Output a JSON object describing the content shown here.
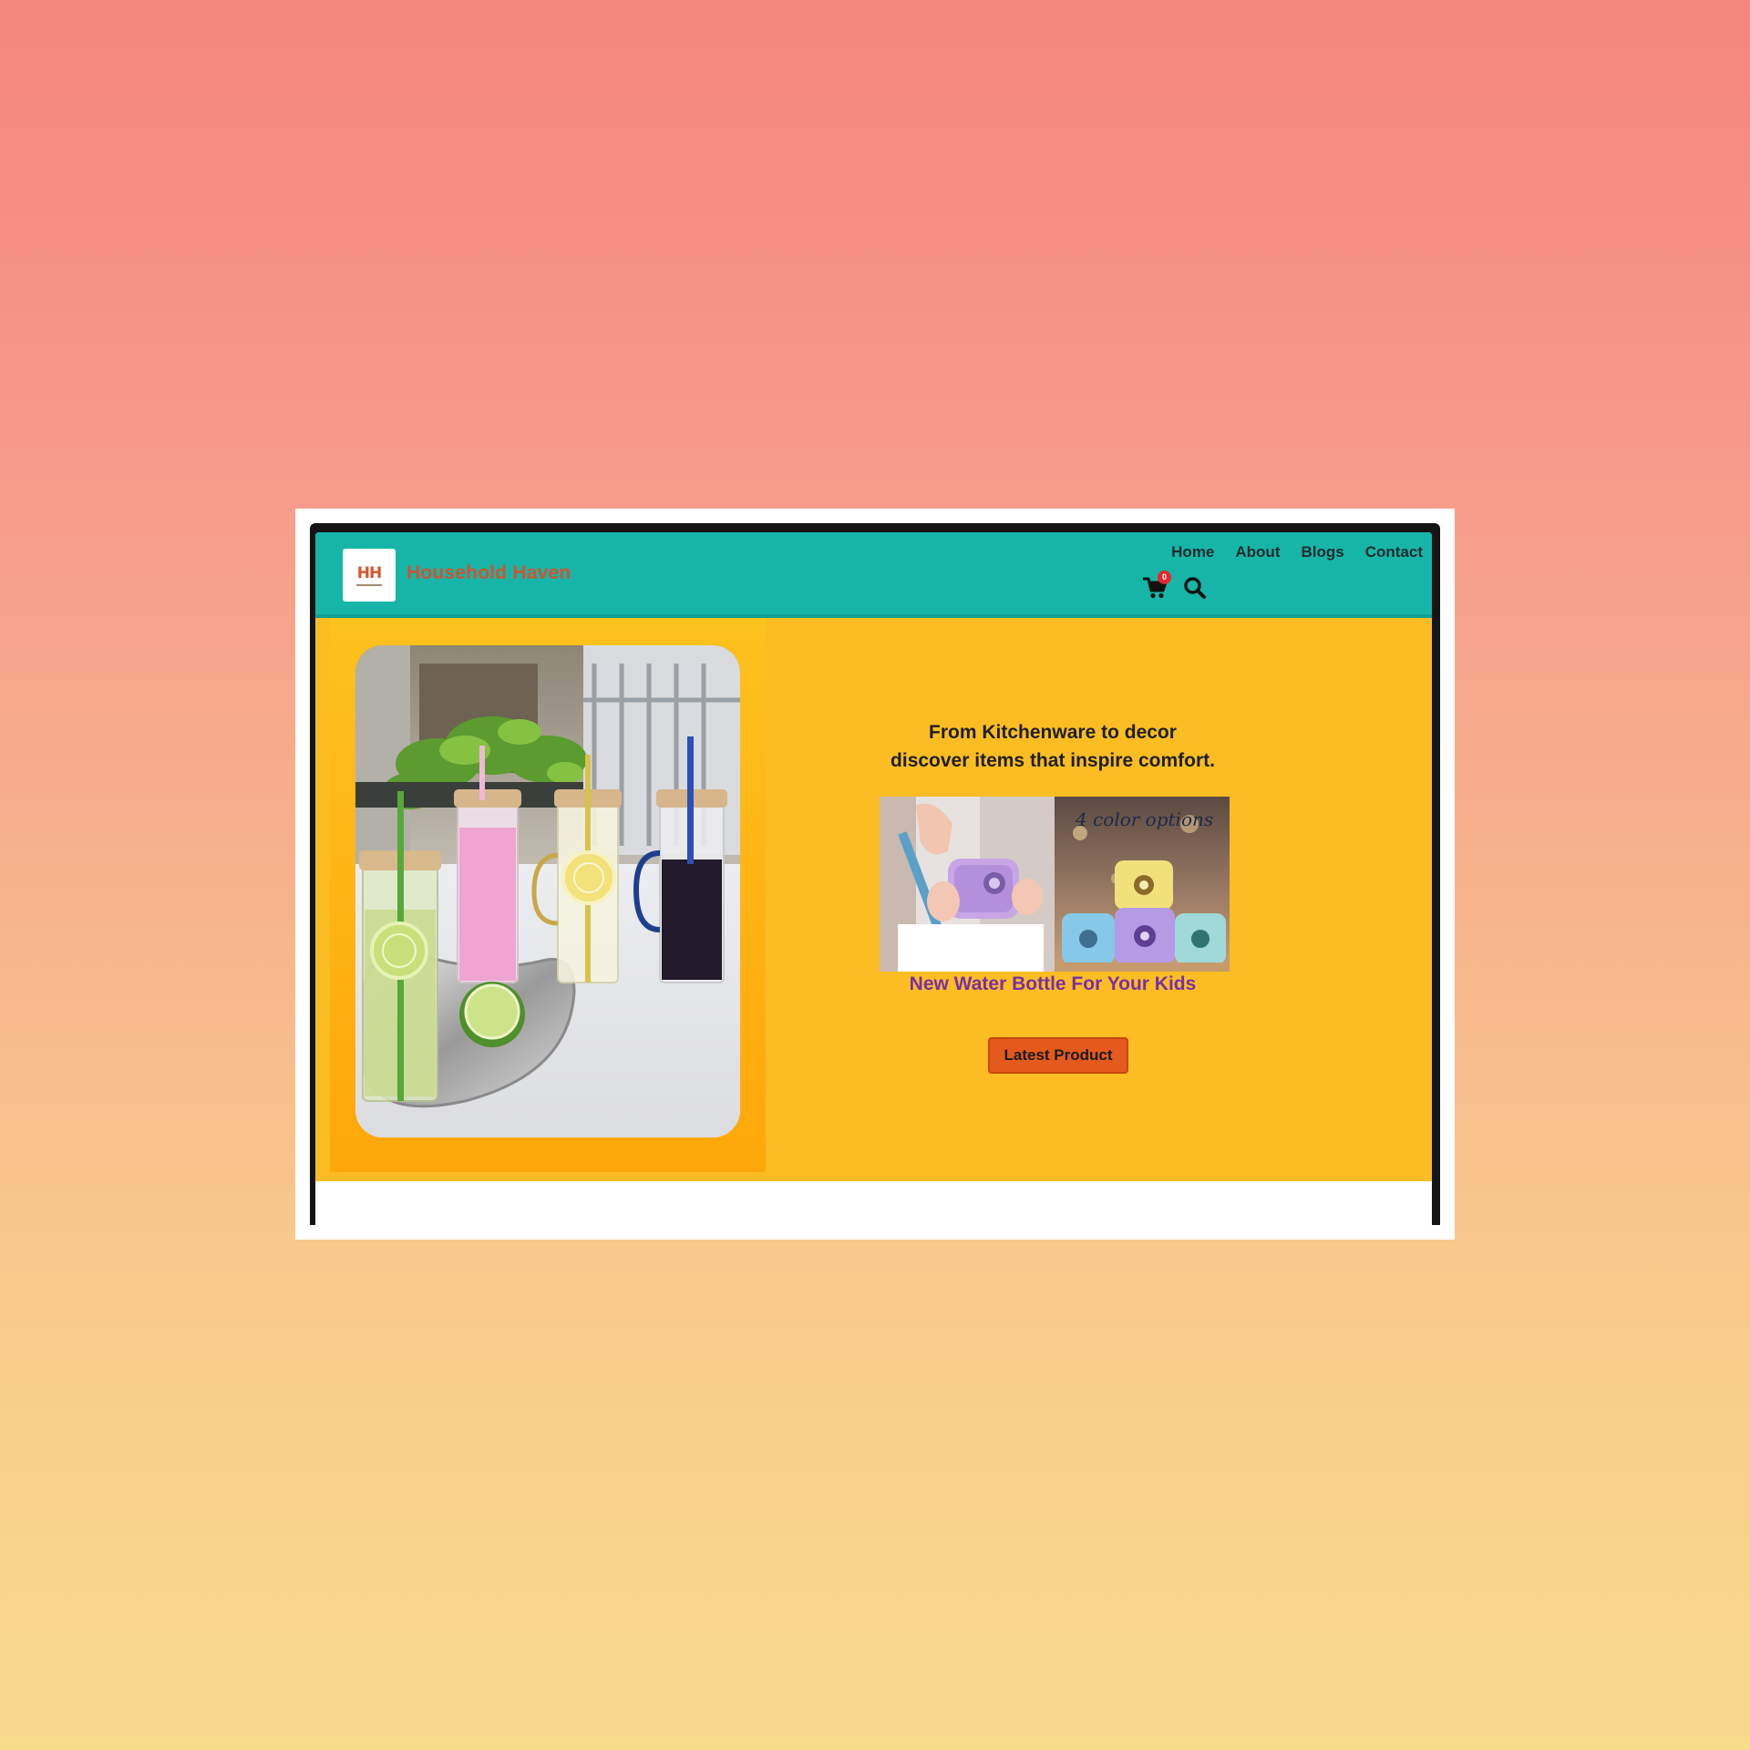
{
  "brand": {
    "logo_text": "HH",
    "name": "Household Haven"
  },
  "nav": {
    "items": [
      "Home",
      "About",
      "Blogs",
      "Contact"
    ]
  },
  "cart": {
    "count": "0"
  },
  "hero": {
    "tagline_line1": "From Kitchenware to decor",
    "tagline_line2": "discover items that inspire comfort.",
    "product_overlay": "4 color options",
    "product_caption": "New Water Bottle For Your Kids",
    "cta_label": "Latest Product"
  },
  "colors": {
    "header": "#17b5a8",
    "brand": "#d2532e",
    "hero_bg": "#fbbd23",
    "caption": "#7a2fa6",
    "cta": "#e45a1d",
    "badge": "#e8262b"
  },
  "icons": {
    "cart": "shopping-cart-icon",
    "search": "search-icon"
  }
}
